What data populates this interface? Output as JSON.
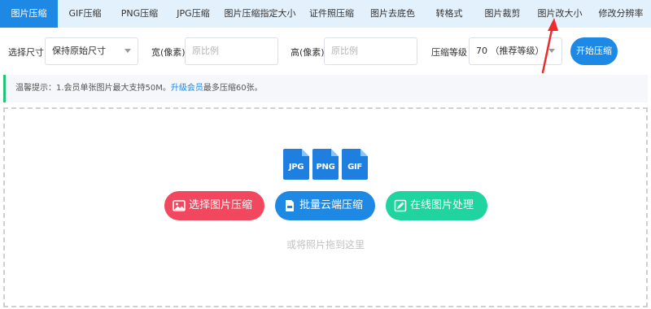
{
  "tabs": [
    {
      "label": "图片压缩",
      "active": true
    },
    {
      "label": "GIF压缩",
      "active": false
    },
    {
      "label": "PNG压缩",
      "active": false
    },
    {
      "label": "JPG压缩",
      "active": false
    },
    {
      "label": "图片压缩指定大小",
      "active": false
    },
    {
      "label": "证件照压缩",
      "active": false
    },
    {
      "label": "图片去底色",
      "active": false
    },
    {
      "label": "转格式",
      "active": false
    },
    {
      "label": "图片裁剪",
      "active": false
    },
    {
      "label": "图片改大小",
      "active": false
    },
    {
      "label": "修改分辨率",
      "active": false
    }
  ],
  "settings": {
    "size_label": "选择尺寸",
    "size_value": "保持原始尺寸",
    "width_label": "宽(像素)",
    "width_placeholder": "原比例",
    "height_label": "高(像素)",
    "height_placeholder": "原比例",
    "level_label": "压缩等级",
    "level_value": "70 （推荐等级）",
    "start_label": "开始压缩"
  },
  "notice": {
    "prefix": "温馨提示：1.会员单张图片最大支持50M。",
    "link": "升级会员",
    "suffix": "最多压缩60张。"
  },
  "upload": {
    "formats": [
      "JPG",
      "PNG",
      "GIF"
    ],
    "select_label": "选择图片压缩",
    "batch_label": "批量云端压缩",
    "online_label": "在线图片处理",
    "drop_hint": "或将照片拖到这里"
  },
  "colors": {
    "tab_active": "#1e88e5",
    "tab_bar": "#e3f1fd",
    "btn_red": "#f2485f",
    "btn_blue": "#1e88e5",
    "btn_green": "#1fd49e",
    "arrow": "#ee2b2b"
  },
  "icons": {
    "select": "image-icon",
    "batch": "zip-file-icon",
    "online": "edit-image-icon",
    "annotation": "red-arrow"
  }
}
